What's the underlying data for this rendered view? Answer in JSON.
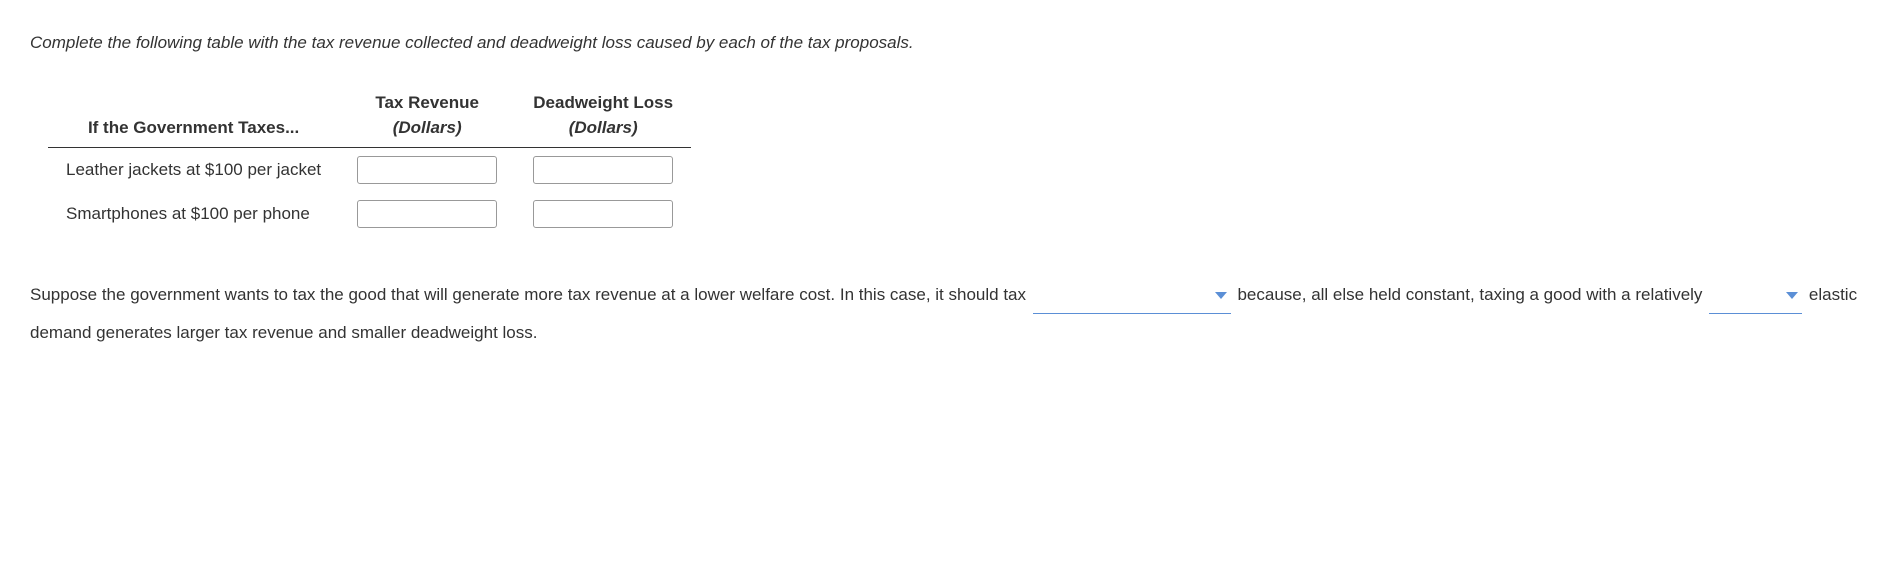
{
  "instruction": "Complete the following table with the tax revenue collected and deadweight loss caused by each of the tax proposals.",
  "table": {
    "col1_header": "If the Government Taxes...",
    "col2_header_line1": "Tax Revenue",
    "col2_header_line2": "(Dollars)",
    "col3_header_line1": "Deadweight Loss",
    "col3_header_line2": "(Dollars)",
    "rows": [
      {
        "label": "Leather jackets at $100 per jacket",
        "tax_revenue": "",
        "deadweight_loss": ""
      },
      {
        "label": "Smartphones at $100 per phone",
        "tax_revenue": "",
        "deadweight_loss": ""
      }
    ]
  },
  "paragraph": {
    "part1": "Suppose the government wants to tax the good that will generate more tax revenue at a lower welfare cost. In this case, it should tax ",
    "drop1_value": "",
    "part2": " because, all else held constant, taxing a good with a relatively ",
    "drop2_value": "",
    "part3": " elastic demand generates larger tax revenue and smaller deadweight loss."
  }
}
